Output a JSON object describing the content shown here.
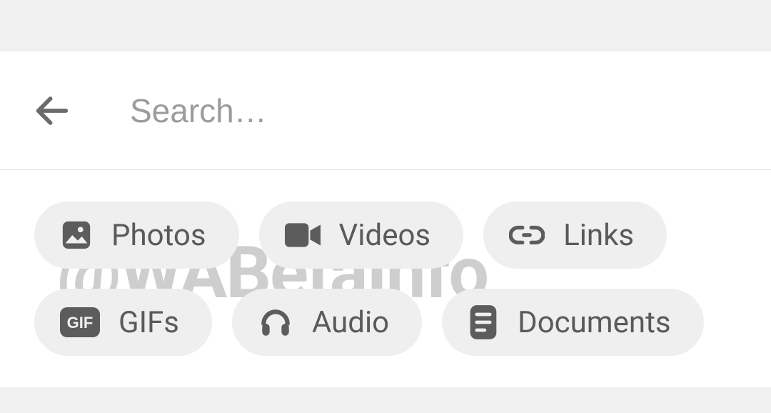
{
  "search": {
    "placeholder": "Search…",
    "value": ""
  },
  "filters": {
    "row1": [
      {
        "key": "photos",
        "label": "Photos",
        "icon": "photos-icon"
      },
      {
        "key": "videos",
        "label": "Videos",
        "icon": "videos-icon"
      },
      {
        "key": "links",
        "label": "Links",
        "icon": "links-icon"
      }
    ],
    "row2": [
      {
        "key": "gifs",
        "label": "GIFs",
        "icon": "gif-icon"
      },
      {
        "key": "audio",
        "label": "Audio",
        "icon": "audio-icon"
      },
      {
        "key": "documents",
        "label": "Documents",
        "icon": "documents-icon"
      }
    ]
  },
  "watermark": "@WABetaInfo"
}
